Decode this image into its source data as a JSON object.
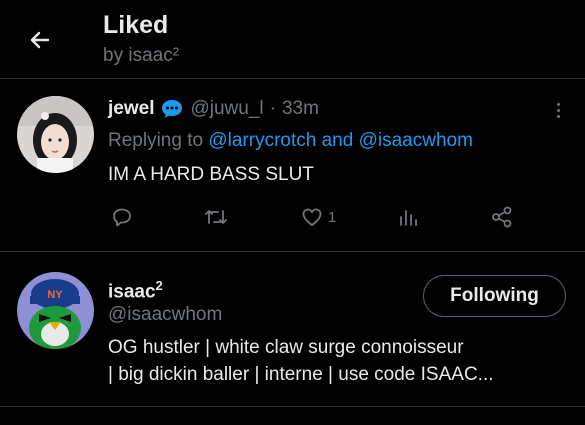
{
  "header": {
    "title": "Liked",
    "subtitle": "by isaac²"
  },
  "tweet": {
    "name": "jewel",
    "handle": "@juwu_l",
    "separator": "·",
    "time": "33m",
    "replying_prefix": "Replying to",
    "mention_1": "@larrycrotch",
    "mention_joiner": "and",
    "mention_2": "@isaacwhom",
    "text": "IM A HARD BASS SLUT",
    "like_count": "1",
    "icons": [
      "back-arrow-icon",
      "verified-chat-icon",
      "more-icon",
      "reply-icon",
      "retweet-icon",
      "like-icon",
      "analytics-icon",
      "share-icon"
    ]
  },
  "user": {
    "name": "isaac",
    "name_sup": "2",
    "handle": "@isaacwhom",
    "follow_label": "Following",
    "bio_line_1": "OG hustler | white claw surge connoisseur",
    "bio_line_2": "| big dickin baller | interne | use code ISAAC..."
  },
  "colors": {
    "background": "#000000",
    "text": "#e7e9ea",
    "secondary": "#71767b",
    "accent": "#1d9bf0",
    "divider": "#2f3336"
  }
}
